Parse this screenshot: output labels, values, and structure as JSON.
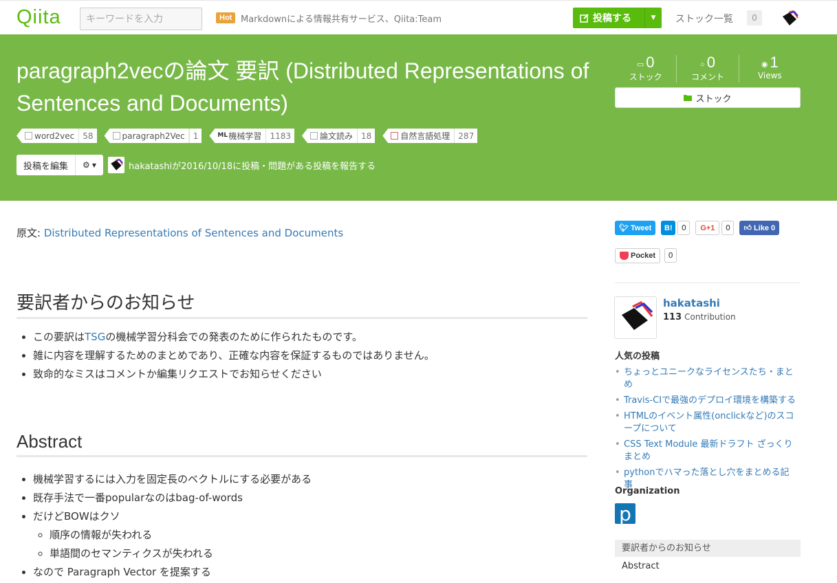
{
  "header": {
    "logo": "Qiita",
    "search_placeholder": "キーワードを入力",
    "hot_badge": "Hot",
    "promo_text": "Markdownによる情報共有サービス、Qiita:Team",
    "post_button": "投稿する",
    "stock_list": "ストック一覧",
    "stock_count": "0"
  },
  "article": {
    "title": "paragraph2vecの論文 要訳 (Distributed Representations of Sentences and Documents)",
    "tags": [
      {
        "name": "word2vec",
        "count": "58"
      },
      {
        "name": "paragraph2Vec",
        "count": "1"
      },
      {
        "name": "機械学習",
        "count": "1183"
      },
      {
        "name": "論文読み",
        "count": "18"
      },
      {
        "name": "自然言語処理",
        "count": "287"
      }
    ],
    "edit_button": "投稿を編集",
    "author_line": "hakatashiが2016/10/18に投稿・問題がある投稿を報告する",
    "source_prefix": "原文: ",
    "source_link": "Distributed Representations of Sentences and Documents",
    "section1_title": "要訳者からのお知らせ",
    "section1_items": {
      "i0_pre": "この要訳は",
      "i0_link": "TSG",
      "i0_post": "の機械学習分科会での発表のために作られたものです。",
      "i1": "雑に内容を理解するためのまとめであり、正確な内容を保証するものではありません。",
      "i2": "致命的なミスはコメントか編集リクエストでお知らせください"
    },
    "section2_title": "Abstract",
    "section2_items": {
      "i0": "機械学習するには入力を固定長のベクトルにする必要がある",
      "i1": "既存手法で一番popularなのはbag-of-words",
      "i2": "だけどBOWはクソ",
      "i2a": "順序の情報が失われる",
      "i2b": "単語間のセマンティクスが失われる",
      "i3": "なので Paragraph Vector を提案する"
    }
  },
  "stats": {
    "stock_num": "0",
    "stock_label": "ストック",
    "comment_num": "0",
    "comment_label": "コメント",
    "views_num": "1",
    "views_label": "Views",
    "stock_button": "ストック"
  },
  "sidebar": {
    "share": {
      "tweet": "Tweet",
      "hatena": "B!",
      "hatena_count": "0",
      "gplus": "G+1",
      "gplus_count": "0",
      "fb": "Like 0",
      "pocket": "Pocket",
      "pocket_count": "0"
    },
    "profile": {
      "name": "hakatashi",
      "contribution_num": "113",
      "contribution_label": "Contribution"
    },
    "popular_heading": "人気の投稿",
    "popular": [
      "ちょっとユニークなライセンスたち・まとめ",
      "Travis-CIで最強のデプロイ環境を構築する",
      "HTMLのイベント属性(onclickなど)のスコープについて",
      "CSS Text Module 最新ドラフト ざっくりまとめ",
      "pythonでハマった落とし穴をまとめる記事"
    ],
    "org_heading": "Organization",
    "org_logo": "p",
    "toc": {
      "head": "要訳者からのお知らせ",
      "item": "Abstract"
    }
  },
  "colors": {
    "brand_green": "#59bb0c",
    "banner_green": "#77b847",
    "link_blue": "#337ab7"
  }
}
